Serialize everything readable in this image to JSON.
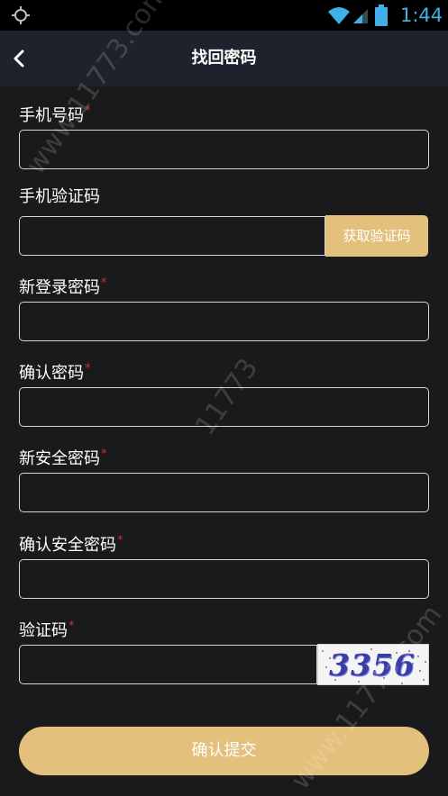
{
  "status_bar": {
    "time": "1:44",
    "icons": [
      "gps-icon",
      "wifi-icon",
      "signal-icon",
      "battery-icon"
    ],
    "time_color": "#3fb0e8"
  },
  "nav": {
    "title": "找回密码",
    "back_icon": "chevron-left-icon"
  },
  "form": {
    "phone_label": "手机号码",
    "sms_label": "手机验证码",
    "sms_button": "获取验证码",
    "new_password_label": "新登录密码",
    "confirm_password_label": "确认密码",
    "new_safe_password_label": "新安全密码",
    "confirm_safe_password_label": "确认安全密码",
    "captcha_label": "验证码",
    "captcha_code": "3356",
    "required_mark": "*",
    "submit_label": "确认提交"
  },
  "watermarks": [
    "www.11773.com",
    "11773",
    "www.11773.com"
  ],
  "colors": {
    "accent": "#e3c07c",
    "background": "#1a1a1c",
    "nav_background": "#1e222c",
    "required": "#d32f2f"
  }
}
